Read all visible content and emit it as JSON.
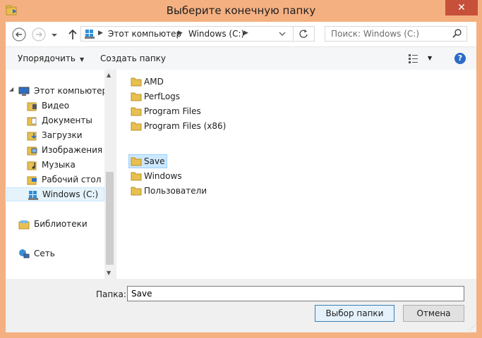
{
  "window": {
    "title": "Выберите конечную папку",
    "close_glyph": "✕"
  },
  "nav": {
    "address_path": [
      "Этот компьютер",
      "Windows (C:)"
    ],
    "search_placeholder": "Поиск: Windows (C:)"
  },
  "commands": {
    "organize": "Упорядочить",
    "new_folder": "Создать папку",
    "help": "?"
  },
  "tree": {
    "this_pc": "Этот компьютер",
    "items": [
      "Видео",
      "Документы",
      "Загрузки",
      "Изображения",
      "Музыка",
      "Рабочий стол",
      "Windows (C:)"
    ],
    "selected": "Windows (C:)",
    "libraries": "Библиотеки",
    "network": "Сеть"
  },
  "files": {
    "items": [
      "AMD",
      "PerfLogs",
      "Program Files",
      "Program Files (x86)",
      "Save",
      "Windows",
      "Пользователи"
    ],
    "selected": "Save"
  },
  "bottom": {
    "folder_label": "Папка:",
    "folder_value": "Save",
    "ok_label": "Выбор папки",
    "cancel_label": "Отмена"
  },
  "colors": {
    "title_bg": "#f4b081",
    "close_bg": "#c7503a",
    "folder_yellow": "#e8c050",
    "selection": "#cce8ff"
  }
}
